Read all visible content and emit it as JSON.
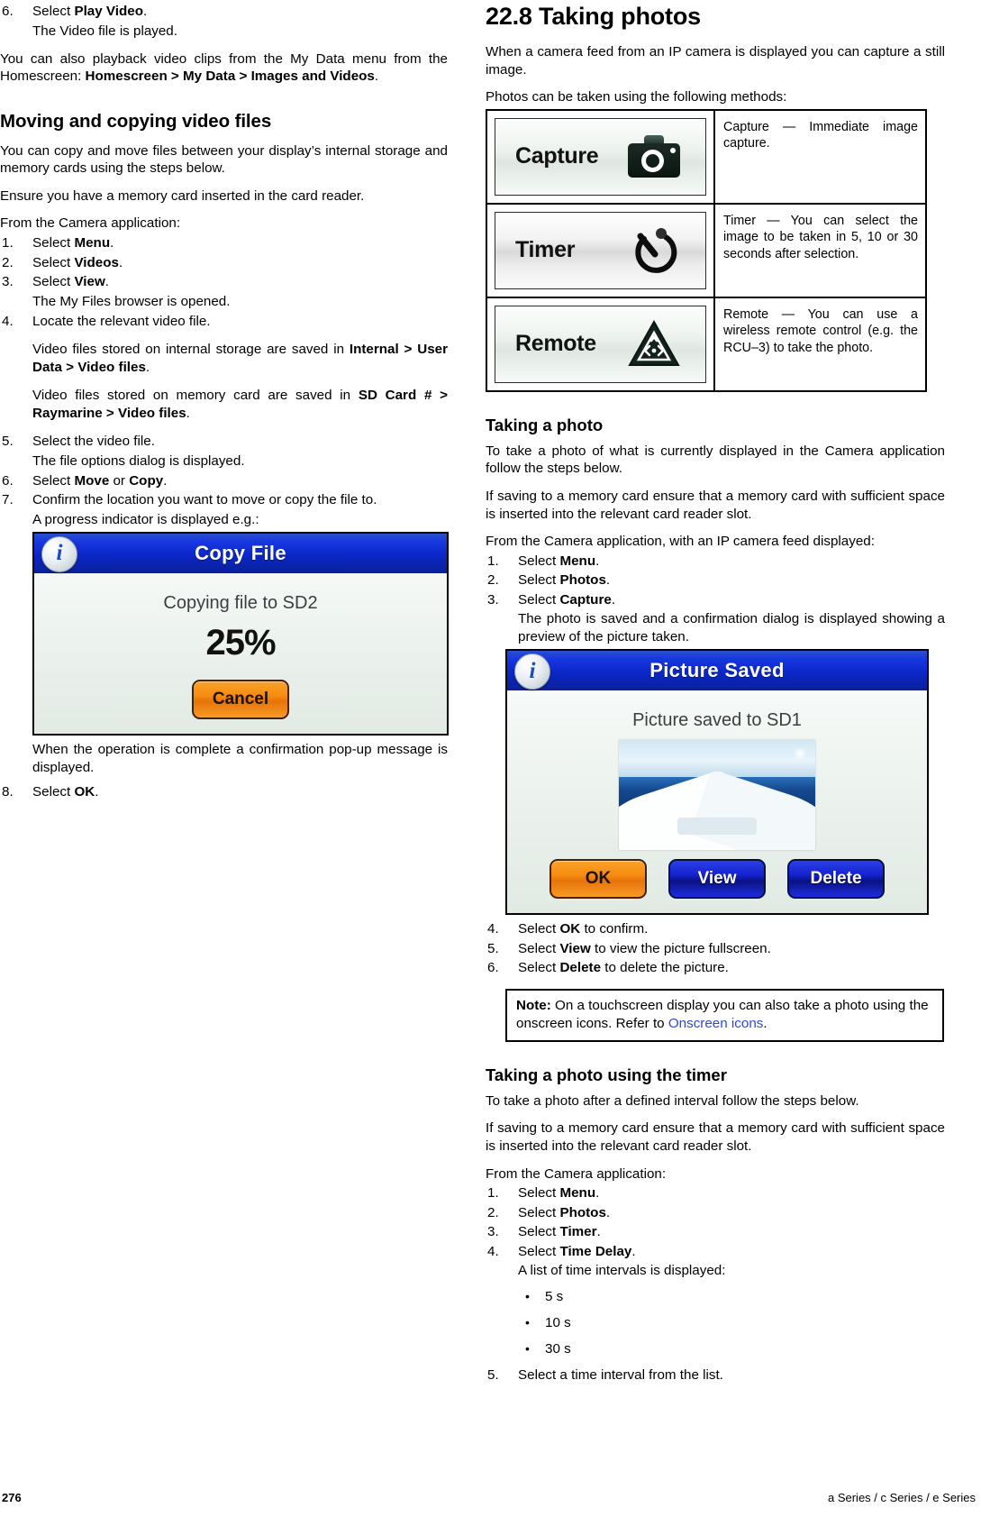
{
  "left_column": {
    "step6": {
      "num": "6.",
      "text_pre": "Select ",
      "bold": "Play Video",
      "text_post": "."
    },
    "step6_result": "The Video file is played.",
    "para_playback": {
      "pre": "You can also playback video clips from the My Data menu from the Homescreen: ",
      "bold": "Homescreen > My Data > Images and Videos",
      "post": "."
    },
    "heading_moving": "Moving and copying video files",
    "para_copy": "You can copy and move files between your display’s internal storage and memory cards using the steps below.",
    "para_ensure": "Ensure you have a memory card inserted in the card reader.",
    "para_from_camera": "From the Camera application:",
    "steps": [
      {
        "num": "1.",
        "pre": "Select ",
        "bold": "Menu",
        "post": "."
      },
      {
        "num": "2.",
        "pre": "Select ",
        "bold": "Videos",
        "post": "."
      },
      {
        "num": "3.",
        "pre": "Select ",
        "bold": "View",
        "post": "."
      }
    ],
    "step3_result": "The My Files browser is opened.",
    "step4": {
      "num": "4.",
      "text": "Locate the relevant video file."
    },
    "step4_note1": {
      "pre": "Video files stored on internal storage are saved in ",
      "bold": "Internal > User Data > Video files",
      "post": "."
    },
    "step4_note2": {
      "pre": "Video files stored on memory card are saved in ",
      "bold": "SD Card # > Raymarine > Video files",
      "post": "."
    },
    "step5": {
      "num": "5.",
      "text": "Select the video file."
    },
    "step5_result": "The file options dialog is displayed.",
    "step6b": {
      "num": "6.",
      "pre": "Select ",
      "bold": "Move",
      "mid": " or ",
      "bold2": "Copy",
      "post": "."
    },
    "step7": {
      "num": "7.",
      "text": "Confirm the location you want to move or copy the file to."
    },
    "step7_result": "A progress indicator is displayed e.g.:",
    "copy_dialog": {
      "title": "Copy File",
      "info_icon": "info-icon",
      "message": "Copying file to SD2",
      "percent": "25%",
      "cancel_label": "Cancel",
      "title_bar_color": "#0b27c8",
      "button_color": "#f68c10"
    },
    "para_complete": "When the operation is complete a confirmation pop-up message is displayed.",
    "step8": {
      "num": "8.",
      "pre": "Select ",
      "bold": "OK",
      "post": "."
    }
  },
  "right_column": {
    "chapter_heading": "22.8 Taking photos",
    "para_intro": "When a camera feed from an IP camera is displayed you can capture a still image.",
    "para_methods": "Photos can be taken using the following methods:",
    "methods_table": {
      "rows": [
        {
          "button_label": "Capture",
          "icon": "camera-icon",
          "description": "Capture — Immediate image capture."
        },
        {
          "button_label": "Timer",
          "icon": "timer-icon",
          "description": "Timer — You can select the image to be taken in 5, 10 or 30 seconds after selection."
        },
        {
          "button_label": "Remote",
          "icon": "remote-icon",
          "description": "Remote — You can use a wireless remote control (e.g. the RCU–3) to take the photo."
        }
      ]
    },
    "heading_taking_photo": "Taking a photo",
    "para_take": "To take a photo of what is currently displayed in the Camera application follow the steps below.",
    "para_saving": "If saving to a memory card ensure that a memory card with sufficient space is inserted into the relevant card reader slot.",
    "para_from_camera_feed": "From the Camera application, with an IP camera feed displayed:",
    "steps": [
      {
        "num": "1.",
        "pre": "Select ",
        "bold": "Menu",
        "post": "."
      },
      {
        "num": "2.",
        "pre": "Select ",
        "bold": "Photos",
        "post": "."
      },
      {
        "num": "3.",
        "pre": "Select ",
        "bold": "Capture",
        "post": "."
      }
    ],
    "step3_result": "The photo is saved and a confirmation dialog is displayed showing a preview of the picture taken.",
    "saved_dialog": {
      "title": "Picture Saved",
      "info_icon": "info-icon",
      "message": "Picture saved to SD1",
      "preview": "boat-bow-sea-photo",
      "buttons": [
        {
          "label": "OK",
          "style": "orange"
        },
        {
          "label": "View",
          "style": "blue"
        },
        {
          "label": "Delete",
          "style": "blue"
        }
      ]
    },
    "steps_after": [
      {
        "num": "4.",
        "pre": "Select ",
        "bold": "OK",
        "post": " to confirm."
      },
      {
        "num": "5.",
        "pre": "Select ",
        "bold": "View",
        "post": " to view the picture fullscreen."
      },
      {
        "num": "6.",
        "pre": "Select ",
        "bold": "Delete",
        "post": " to delete the picture."
      }
    ],
    "note": {
      "label": "Note:",
      "pre": " On a touchscreen display you can also take a photo using the onscreen icons. Refer to ",
      "link": "Onscreen icons",
      "post": ".",
      "link_color": "#2b49d8"
    },
    "heading_timer": "Taking a photo using the timer",
    "para_timer_intro": "To take a photo after a defined interval follow the steps below.",
    "para_timer_saving": "If saving to a memory card ensure that a memory card with sufficient space is inserted into the relevant card reader slot.",
    "para_timer_from": "From the Camera application:",
    "timer_steps": [
      {
        "num": "1.",
        "pre": "Select ",
        "bold": "Menu",
        "post": "."
      },
      {
        "num": "2.",
        "pre": "Select ",
        "bold": "Photos",
        "post": "."
      },
      {
        "num": "3.",
        "pre": "Select ",
        "bold": "Timer",
        "post": "."
      },
      {
        "num": "4.",
        "pre": "Select ",
        "bold": "Time Delay",
        "post": "."
      }
    ],
    "step4_result": "A list of time intervals is displayed:",
    "intervals": [
      "5 s",
      "10 s",
      "30 s"
    ],
    "step5": {
      "num": "5.",
      "text": "Select a time interval from the list."
    }
  },
  "footer": {
    "page_number": "276",
    "series": "a Series / c Series / e Series"
  }
}
